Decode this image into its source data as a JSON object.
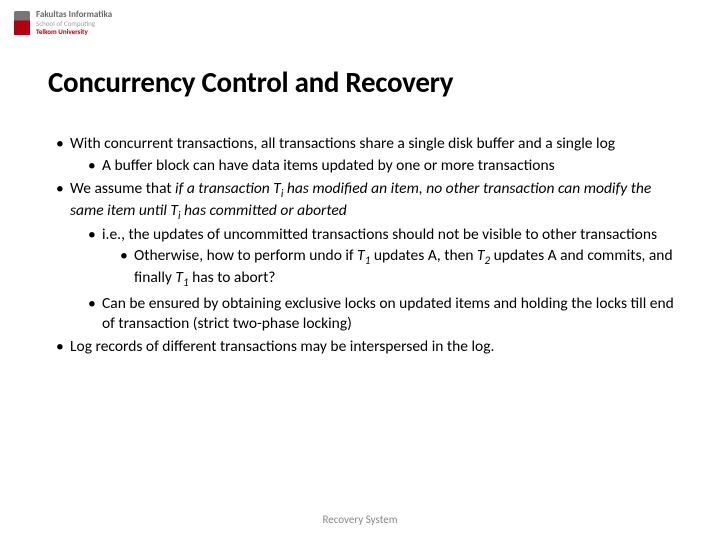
{
  "logo": {
    "line1": "Fakultas Informatika",
    "line2": "School of Computing",
    "line3": "Telkom University"
  },
  "title": "Concurrency Control and Recovery",
  "bullets": {
    "b1": "With concurrent transactions, all transactions share a single disk buffer and a single log",
    "b1_1": "A buffer block can have data items updated by one or more transactions",
    "b2_pre": "We assume that ",
    "b2_it_a": "if a transaction T",
    "b2_sub_i1": "i",
    "b2_it_b": " has modified an item, no other transaction can modify the same item until T",
    "b2_sub_i2": "i",
    "b2_it_c": " has committed or aborted",
    "b2_1": "i.e., the updates of uncommitted transactions should not be visible to other transactions",
    "b2_1_1_a": "Otherwise, how to perform undo if ",
    "b2_1_1_T": "T",
    "b2_1_1_1": "1",
    "b2_1_1_b": " updates A, then ",
    "b2_1_1_2": "2",
    "b2_1_1_c": " updates A and commits, and finally ",
    "b2_1_1_d": " has to abort?",
    "b2_2": "Can be ensured by obtaining exclusive locks on updated items and holding the locks till end of transaction (strict two-phase locking)",
    "b3": "Log records of different transactions may be interspersed in the log."
  },
  "footer": "Recovery System"
}
